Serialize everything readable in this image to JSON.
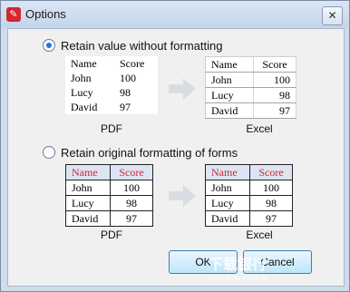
{
  "window": {
    "title": "Options",
    "close_glyph": "✕",
    "app_icon": "pdf-app-icon"
  },
  "options": [
    {
      "label": "Retain value without formatting",
      "checked": true
    },
    {
      "label": "Retain original formatting of forms",
      "checked": false
    }
  ],
  "table_headers": [
    "Name",
    "Score"
  ],
  "table_rows": [
    [
      "John",
      "100"
    ],
    [
      "Lucy",
      "98"
    ],
    [
      "David",
      "97"
    ]
  ],
  "captions": {
    "pdf": "PDF",
    "excel": "Excel"
  },
  "buttons": {
    "ok": "OK",
    "cancel": "Cancel"
  },
  "watermark": {
    "text": "下载银行",
    "sub": "www.downbank.cn"
  },
  "colors": {
    "accent_header_text": "#cc2a2a",
    "header_fill": "#dde5f5",
    "radio_dot": "#2d6fd6"
  }
}
